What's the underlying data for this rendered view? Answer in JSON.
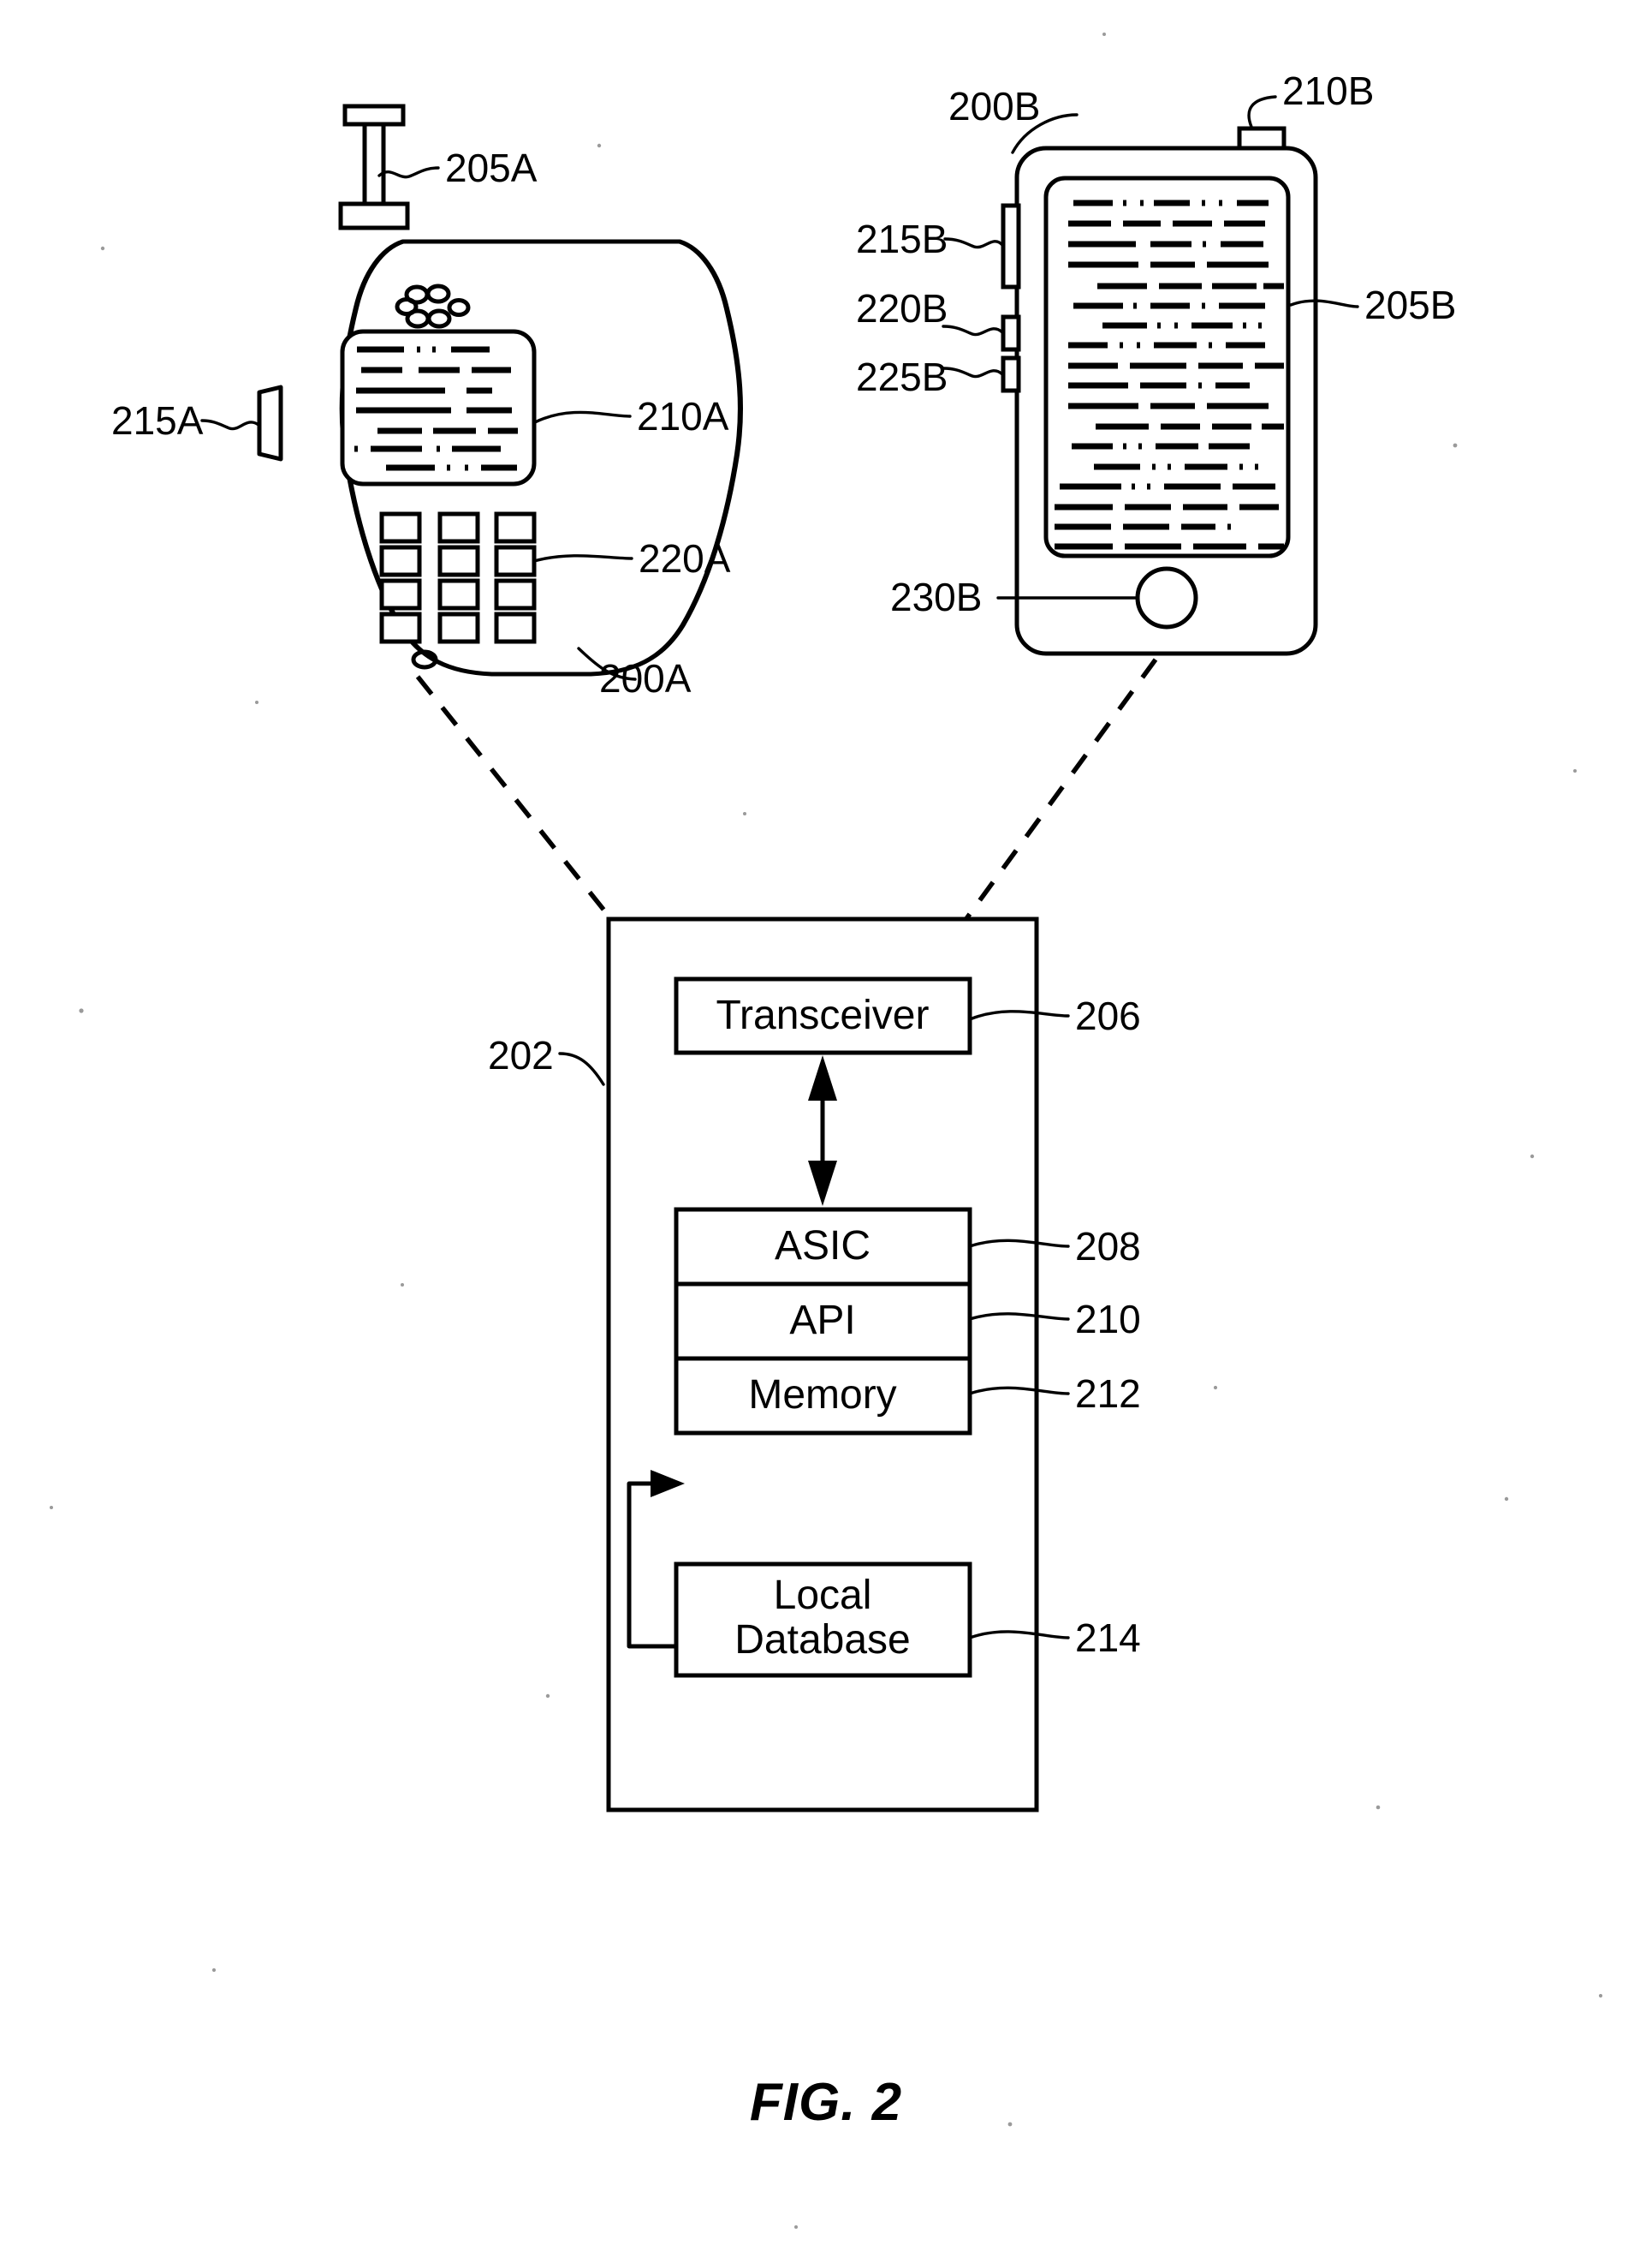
{
  "figure": {
    "caption": "FIG. 2",
    "type": "patent-diagram"
  },
  "devices": {
    "radio": {
      "name": "two-way-radio",
      "ref": "200A",
      "antenna_ref": "205A",
      "display_ref": "210A",
      "keypad_ref": "220A",
      "side_button_ref": "215A",
      "keypad_rows": 4,
      "keypad_cols": 3,
      "speaker_holes": 6
    },
    "smartphone": {
      "name": "smartphone",
      "ref": "200B",
      "top_connector_ref": "210B",
      "display_ref": "205B",
      "side_button_long_ref": "215B",
      "side_button_mid_ref": "220B",
      "side_button_low_ref": "225B",
      "home_button_ref": "230B"
    }
  },
  "block_diagram": {
    "container_ref": "202",
    "blocks": [
      {
        "label": "Transceiver",
        "ref": "206"
      },
      {
        "label": "ASIC",
        "ref": "208"
      },
      {
        "label": "API",
        "ref": "210"
      },
      {
        "label": "Memory",
        "ref": "212"
      },
      {
        "label": "Local\nDatabase",
        "ref": "214",
        "line1": "Local",
        "line2": "Database"
      }
    ]
  },
  "colors": {
    "ink": "#000000",
    "paper": "#ffffff"
  }
}
